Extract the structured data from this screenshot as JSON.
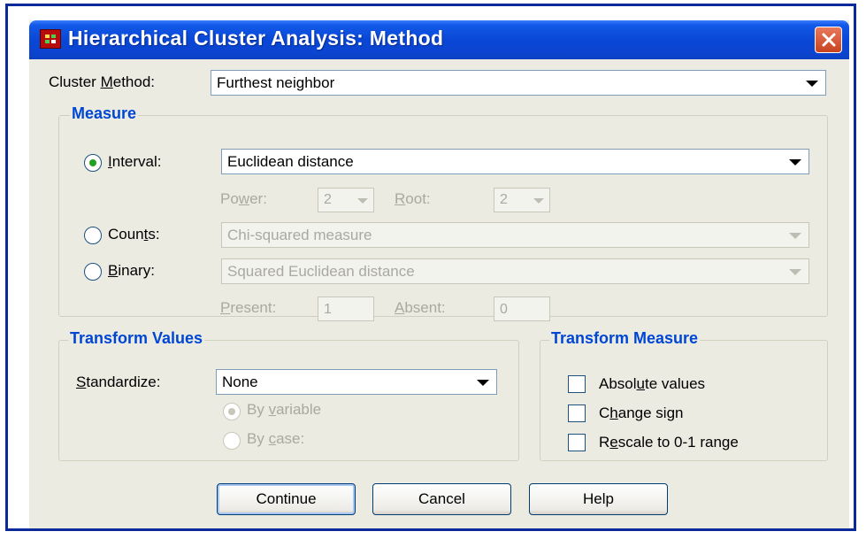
{
  "window": {
    "title": "Hierarchical Cluster Analysis: Method",
    "app_icon": "spss-grid-icon",
    "close_icon": "close-icon"
  },
  "cluster_method": {
    "label_pre": "Cluster ",
    "label_mnemonic": "M",
    "label_post": "ethod:",
    "value": "Furthest neighbor"
  },
  "measure": {
    "title": "Measure",
    "interval": {
      "label_pre": "",
      "label_mnemonic": "I",
      "label_post": "nterval:",
      "selected": true,
      "value": "Euclidean distance"
    },
    "power": {
      "label_pre": "Po",
      "label_mnemonic": "w",
      "label_post": "er:",
      "value": "2"
    },
    "root": {
      "label_pre": "",
      "label_mnemonic": "R",
      "label_post": "oot:",
      "value": "2"
    },
    "counts": {
      "label_pre": "Coun",
      "label_mnemonic": "t",
      "label_post": "s:",
      "selected": false,
      "value": "Chi-squared measure"
    },
    "binary": {
      "label_pre": "",
      "label_mnemonic": "B",
      "label_post": "inary:",
      "selected": false,
      "value": "Squared Euclidean distance"
    },
    "present": {
      "label_pre": "",
      "label_mnemonic": "P",
      "label_post": "resent:",
      "value": "1"
    },
    "absent": {
      "label_pre": "",
      "label_mnemonic": "A",
      "label_post": "bsent:",
      "value": "0"
    }
  },
  "transform_values": {
    "title": "Transform Values",
    "standardize": {
      "label_pre": "",
      "label_mnemonic": "S",
      "label_post": "tandardize:",
      "value": "None"
    },
    "by_variable": {
      "label_pre": "By ",
      "label_mnemonic": "v",
      "label_post": "ariable",
      "selected": true
    },
    "by_case": {
      "label_pre": "By ",
      "label_mnemonic": "c",
      "label_post": "ase:",
      "selected": false
    }
  },
  "transform_measure": {
    "title": "Transform Measure",
    "absolute_values": {
      "label_pre": "Absol",
      "label_mnemonic": "u",
      "label_post": "te values",
      "checked": false
    },
    "change_sign": {
      "label_pre": "C",
      "label_mnemonic": "h",
      "label_post": "ange sign",
      "checked": false
    },
    "rescale": {
      "label_pre": "R",
      "label_mnemonic": "e",
      "label_post": "scale to 0-1 range",
      "checked": false
    }
  },
  "buttons": {
    "continue": "Continue",
    "cancel": "Cancel",
    "help": "Help"
  },
  "colors": {
    "titlebar": "#0a47d6",
    "group_title": "#0046d5",
    "dialog_bg": "#ecebe1",
    "close_button": "#c8431f"
  }
}
